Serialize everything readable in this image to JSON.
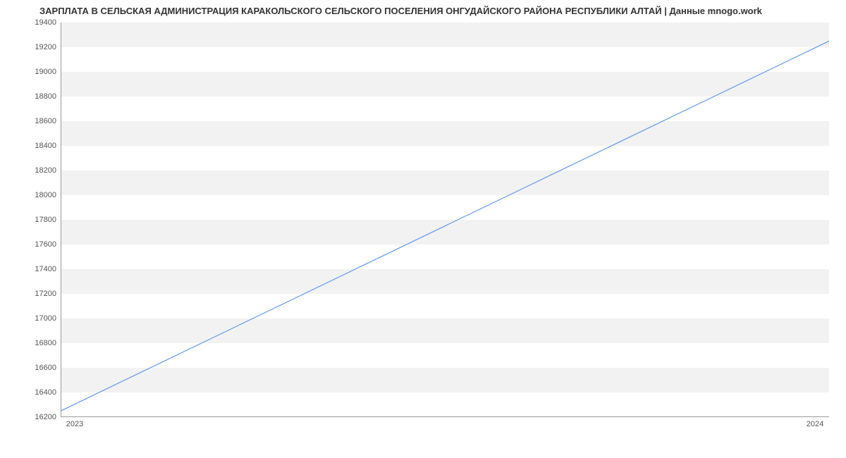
{
  "chart_data": {
    "type": "line",
    "title": "ЗАРПЛАТА В СЕЛЬСКАЯ АДМИНИСТРАЦИЯ КАРАКОЛЬСКОГО СЕЛЬСКОГО ПОСЕЛЕНИЯ ОНГУДАЙСКОГО РАЙОНА РЕСПУБЛИКИ АЛТАЙ | Данные mnogo.work",
    "x": [
      "2023",
      "2024"
    ],
    "series": [
      {
        "name": "salary",
        "values": [
          16250,
          19250
        ]
      }
    ],
    "xlabel": "",
    "ylabel": "",
    "ylim": [
      16200,
      19400
    ],
    "yticks": [
      16200,
      16400,
      16600,
      16800,
      17000,
      17200,
      17400,
      17600,
      17800,
      18000,
      18200,
      18400,
      18600,
      18800,
      19000,
      19200,
      19400
    ],
    "xticks": [
      "2023",
      "2024"
    ],
    "line_color": "#6f9fe8"
  }
}
